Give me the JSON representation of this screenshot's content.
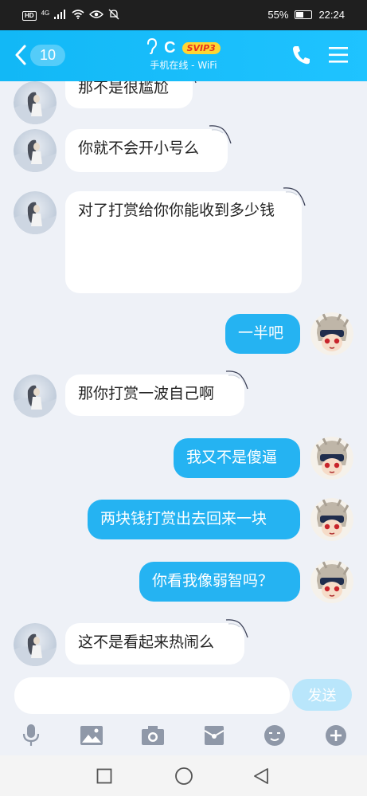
{
  "status_bar": {
    "net": "4G",
    "battery": "55%",
    "battery_level": 0.55,
    "time": "22:24"
  },
  "header": {
    "back_count": "10",
    "contact_name": "C",
    "vip_badge": "SVIP3",
    "subtitle": "手机在线 - WiFi"
  },
  "messages": [
    {
      "side": "in",
      "text": "那不是很尴尬"
    },
    {
      "side": "in",
      "text": "你就不会开小号么"
    },
    {
      "side": "in",
      "text": "对了打赏给你你能收到多少钱"
    },
    {
      "side": "out",
      "text": "一半吧"
    },
    {
      "side": "in",
      "text": "那你打赏一波自己啊"
    },
    {
      "side": "out",
      "text": "我又不是傻逼"
    },
    {
      "side": "out",
      "text": "两块钱打赏出去回来一块"
    },
    {
      "side": "out",
      "text": "你看我像弱智吗？"
    },
    {
      "side": "in",
      "text": "这不是看起来热闹么"
    }
  ],
  "input": {
    "value": "",
    "send_label": "发送"
  },
  "toolbar": [
    "mic-icon",
    "image-icon",
    "camera-icon",
    "red-packet-icon",
    "emoji-icon",
    "plus-icon"
  ],
  "colors": {
    "header": "#1fbcf8",
    "out_bubble": "#25b3f2",
    "in_bubble": "#ffffff",
    "background": "#eef1f7",
    "send_button": "#b9e6fb"
  }
}
